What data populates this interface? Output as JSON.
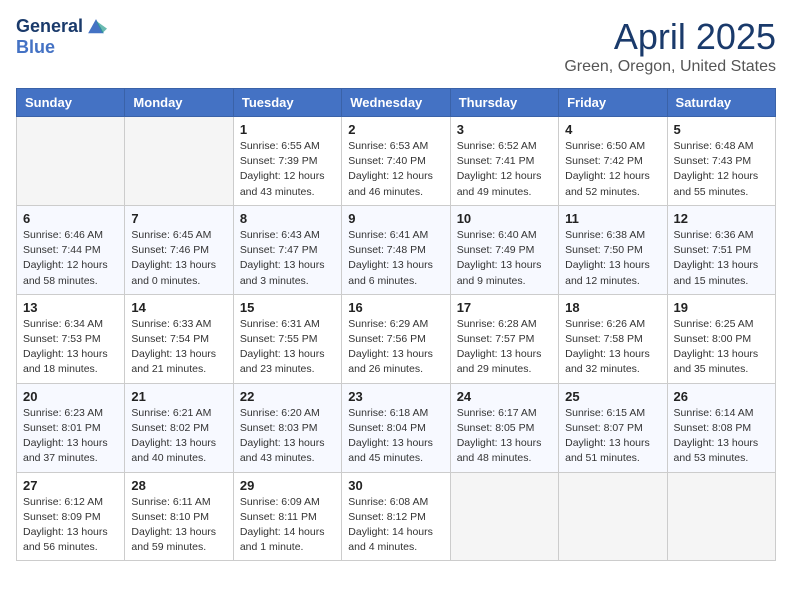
{
  "logo": {
    "line1": "General",
    "line2": "Blue"
  },
  "title": "April 2025",
  "location": "Green, Oregon, United States",
  "weekdays": [
    "Sunday",
    "Monday",
    "Tuesday",
    "Wednesday",
    "Thursday",
    "Friday",
    "Saturday"
  ],
  "weeks": [
    [
      {
        "day": "",
        "info": ""
      },
      {
        "day": "",
        "info": ""
      },
      {
        "day": "1",
        "info": "Sunrise: 6:55 AM\nSunset: 7:39 PM\nDaylight: 12 hours and 43 minutes."
      },
      {
        "day": "2",
        "info": "Sunrise: 6:53 AM\nSunset: 7:40 PM\nDaylight: 12 hours and 46 minutes."
      },
      {
        "day": "3",
        "info": "Sunrise: 6:52 AM\nSunset: 7:41 PM\nDaylight: 12 hours and 49 minutes."
      },
      {
        "day": "4",
        "info": "Sunrise: 6:50 AM\nSunset: 7:42 PM\nDaylight: 12 hours and 52 minutes."
      },
      {
        "day": "5",
        "info": "Sunrise: 6:48 AM\nSunset: 7:43 PM\nDaylight: 12 hours and 55 minutes."
      }
    ],
    [
      {
        "day": "6",
        "info": "Sunrise: 6:46 AM\nSunset: 7:44 PM\nDaylight: 12 hours and 58 minutes."
      },
      {
        "day": "7",
        "info": "Sunrise: 6:45 AM\nSunset: 7:46 PM\nDaylight: 13 hours and 0 minutes."
      },
      {
        "day": "8",
        "info": "Sunrise: 6:43 AM\nSunset: 7:47 PM\nDaylight: 13 hours and 3 minutes."
      },
      {
        "day": "9",
        "info": "Sunrise: 6:41 AM\nSunset: 7:48 PM\nDaylight: 13 hours and 6 minutes."
      },
      {
        "day": "10",
        "info": "Sunrise: 6:40 AM\nSunset: 7:49 PM\nDaylight: 13 hours and 9 minutes."
      },
      {
        "day": "11",
        "info": "Sunrise: 6:38 AM\nSunset: 7:50 PM\nDaylight: 13 hours and 12 minutes."
      },
      {
        "day": "12",
        "info": "Sunrise: 6:36 AM\nSunset: 7:51 PM\nDaylight: 13 hours and 15 minutes."
      }
    ],
    [
      {
        "day": "13",
        "info": "Sunrise: 6:34 AM\nSunset: 7:53 PM\nDaylight: 13 hours and 18 minutes."
      },
      {
        "day": "14",
        "info": "Sunrise: 6:33 AM\nSunset: 7:54 PM\nDaylight: 13 hours and 21 minutes."
      },
      {
        "day": "15",
        "info": "Sunrise: 6:31 AM\nSunset: 7:55 PM\nDaylight: 13 hours and 23 minutes."
      },
      {
        "day": "16",
        "info": "Sunrise: 6:29 AM\nSunset: 7:56 PM\nDaylight: 13 hours and 26 minutes."
      },
      {
        "day": "17",
        "info": "Sunrise: 6:28 AM\nSunset: 7:57 PM\nDaylight: 13 hours and 29 minutes."
      },
      {
        "day": "18",
        "info": "Sunrise: 6:26 AM\nSunset: 7:58 PM\nDaylight: 13 hours and 32 minutes."
      },
      {
        "day": "19",
        "info": "Sunrise: 6:25 AM\nSunset: 8:00 PM\nDaylight: 13 hours and 35 minutes."
      }
    ],
    [
      {
        "day": "20",
        "info": "Sunrise: 6:23 AM\nSunset: 8:01 PM\nDaylight: 13 hours and 37 minutes."
      },
      {
        "day": "21",
        "info": "Sunrise: 6:21 AM\nSunset: 8:02 PM\nDaylight: 13 hours and 40 minutes."
      },
      {
        "day": "22",
        "info": "Sunrise: 6:20 AM\nSunset: 8:03 PM\nDaylight: 13 hours and 43 minutes."
      },
      {
        "day": "23",
        "info": "Sunrise: 6:18 AM\nSunset: 8:04 PM\nDaylight: 13 hours and 45 minutes."
      },
      {
        "day": "24",
        "info": "Sunrise: 6:17 AM\nSunset: 8:05 PM\nDaylight: 13 hours and 48 minutes."
      },
      {
        "day": "25",
        "info": "Sunrise: 6:15 AM\nSunset: 8:07 PM\nDaylight: 13 hours and 51 minutes."
      },
      {
        "day": "26",
        "info": "Sunrise: 6:14 AM\nSunset: 8:08 PM\nDaylight: 13 hours and 53 minutes."
      }
    ],
    [
      {
        "day": "27",
        "info": "Sunrise: 6:12 AM\nSunset: 8:09 PM\nDaylight: 13 hours and 56 minutes."
      },
      {
        "day": "28",
        "info": "Sunrise: 6:11 AM\nSunset: 8:10 PM\nDaylight: 13 hours and 59 minutes."
      },
      {
        "day": "29",
        "info": "Sunrise: 6:09 AM\nSunset: 8:11 PM\nDaylight: 14 hours and 1 minute."
      },
      {
        "day": "30",
        "info": "Sunrise: 6:08 AM\nSunset: 8:12 PM\nDaylight: 14 hours and 4 minutes."
      },
      {
        "day": "",
        "info": ""
      },
      {
        "day": "",
        "info": ""
      },
      {
        "day": "",
        "info": ""
      }
    ]
  ]
}
